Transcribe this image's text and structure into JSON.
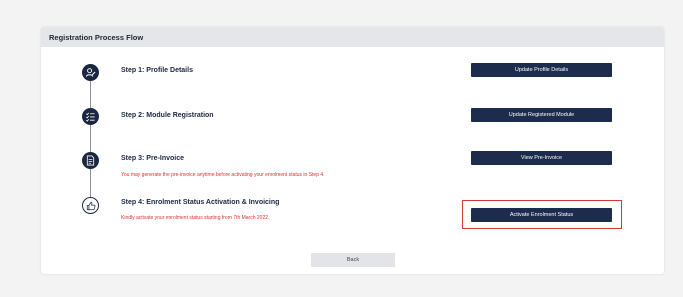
{
  "panel": {
    "title": "Registration Process Flow"
  },
  "steps": [
    {
      "title": "Step 1: Profile Details",
      "note": "",
      "button": "Update Profile Details",
      "icon": "profile-edit-icon"
    },
    {
      "title": "Step 2: Module Registration",
      "note": "",
      "button": "Update Registered Module",
      "icon": "checklist-icon"
    },
    {
      "title": "Step 3: Pre-Invoice",
      "note": "You may generate the pre-invoice anytime before activating your enrolment status in Step 4.",
      "button": "View Pre-Invoice",
      "icon": "invoice-icon"
    },
    {
      "title": "Step 4: Enrolment Status Activation & Invoicing",
      "note": "Kindly activate your enrolment status starting from 7th March 2022.",
      "button": "Activate Enrolment Status",
      "icon": "thumbs-up-icon"
    }
  ],
  "footer": {
    "back_label": "Back"
  },
  "colors": {
    "navy": "#1d2b4c",
    "alert_red": "#d9332d",
    "header_bg": "#e4e6e9"
  }
}
